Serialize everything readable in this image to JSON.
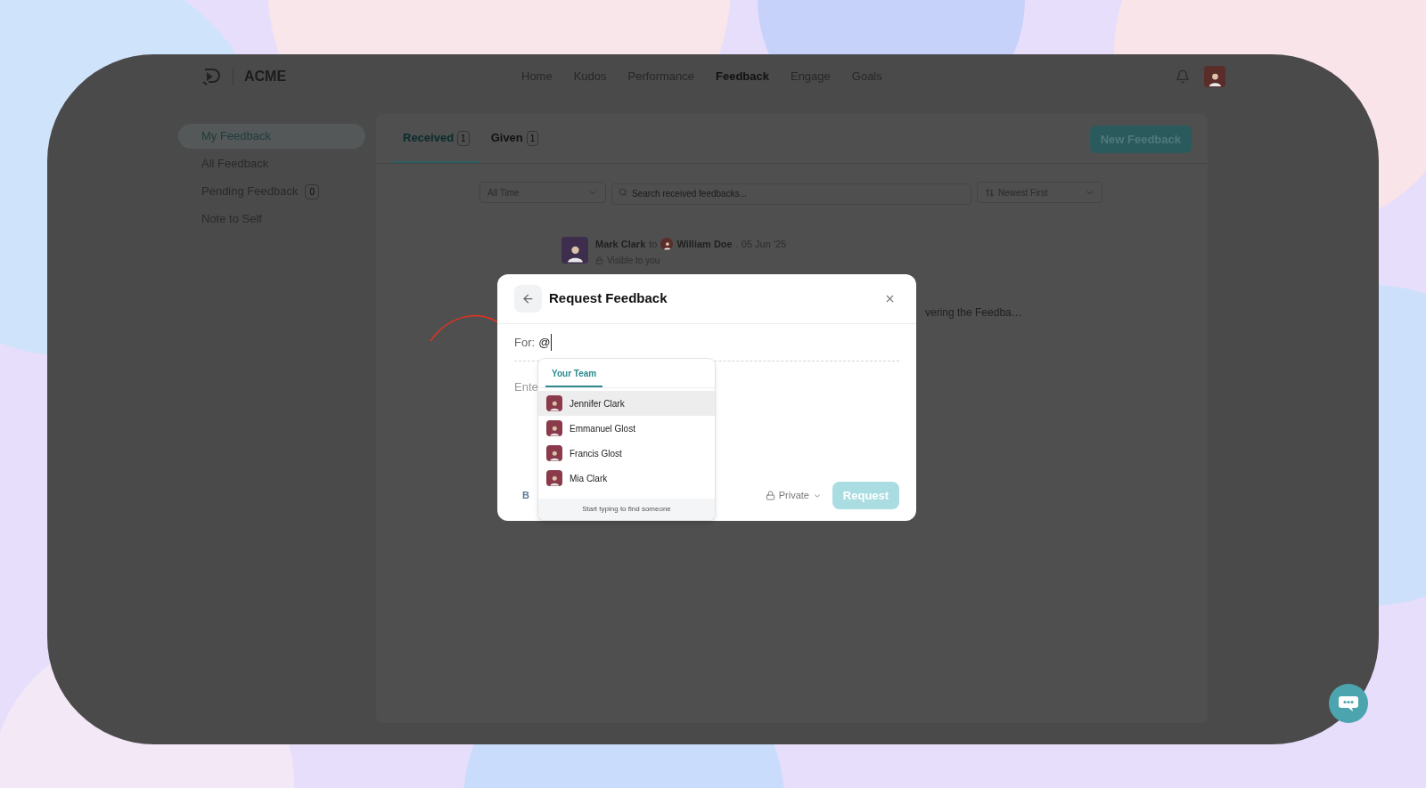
{
  "brand": {
    "name": "ACME"
  },
  "nav": [
    {
      "label": "Home",
      "selected": false
    },
    {
      "label": "Kudos",
      "selected": false
    },
    {
      "label": "Performance",
      "selected": false
    },
    {
      "label": "Feedback",
      "selected": true
    },
    {
      "label": "Engage",
      "selected": false
    },
    {
      "label": "Goals",
      "selected": false
    }
  ],
  "sidebar": [
    {
      "label": "My Feedback",
      "selected": true
    },
    {
      "label": "All Feedback",
      "selected": false
    },
    {
      "label": "Pending Feedback",
      "selected": false,
      "count": "0"
    },
    {
      "label": "Note to Self",
      "selected": false
    }
  ],
  "tabs": [
    {
      "label": "Received",
      "count": "1",
      "selected": true
    },
    {
      "label": "Given",
      "count": "1",
      "selected": false
    }
  ],
  "new_feedback": "New Feedback",
  "filters": {
    "period": "All Time",
    "search_placeholder": "Search received feedbacks...",
    "sort": "Newest First"
  },
  "feedback": {
    "author": "Mark Clark",
    "to": "to",
    "recipient": "William Doe",
    "date": ". 05 Jun '25",
    "visibility": "Visible to you",
    "snippet": "vering the Feedba…"
  },
  "modal": {
    "title": "Request Feedback",
    "for_label": "For:",
    "for_value": "@",
    "body_placeholder": "Ente",
    "bold": "B",
    "privacy": "Private",
    "request": "Request",
    "request_disabled": true,
    "dropdown": {
      "tab": "Your Team",
      "hint": "Start typing to find someone",
      "people": [
        {
          "name": "Jennifer Clark",
          "selected": true
        },
        {
          "name": "Emmanuel Glost",
          "selected": false
        },
        {
          "name": "Francis Glost",
          "selected": false
        },
        {
          "name": "Mia Clark",
          "selected": false
        }
      ]
    }
  }
}
